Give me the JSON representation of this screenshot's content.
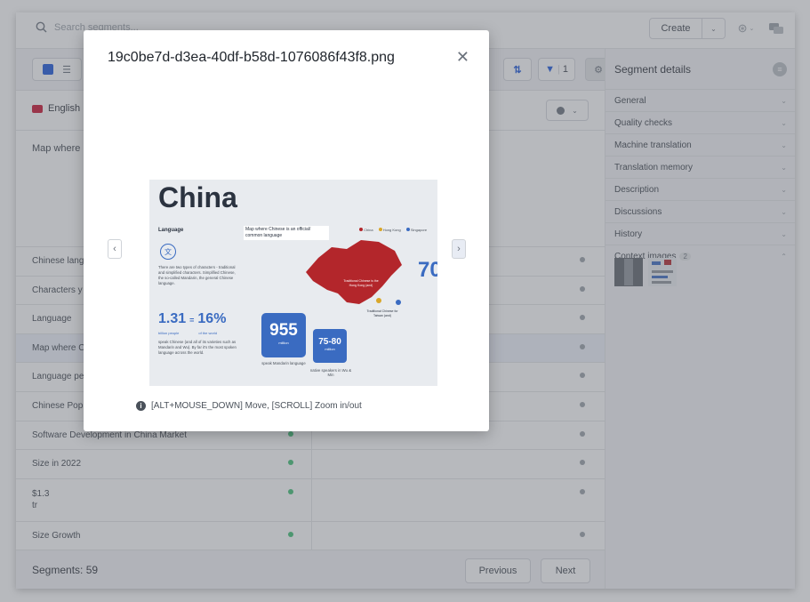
{
  "topbar": {
    "search_placeholder": "Search segments...",
    "create_label": "Create"
  },
  "toolbar": {
    "filter_count": "1"
  },
  "lang": {
    "source_language": "English"
  },
  "editor": {
    "source_text_preview": "Map where"
  },
  "segments": [
    {
      "source": "Chinese lang",
      "selected": false
    },
    {
      "source": "Characters y",
      "selected": false
    },
    {
      "source": "Language",
      "selected": false
    },
    {
      "source": "Map where C",
      "selected": true
    },
    {
      "source": "Language pe",
      "selected": false
    },
    {
      "source": "Chinese Pop",
      "selected": false
    },
    {
      "source": "Software Development in China Market",
      "selected": false
    },
    {
      "source": "Size in 2022",
      "selected": false
    },
    {
      "source_line1": "$1.3",
      "source_line2": "tr",
      "selected": false
    },
    {
      "source": "Size Growth",
      "selected": false
    }
  ],
  "footer": {
    "segments_count": "Segments: 59",
    "previous_label": "Previous",
    "next_label": "Next"
  },
  "right_panel": {
    "title": "Segment details",
    "sections": [
      {
        "label": "General"
      },
      {
        "label": "Quality checks"
      },
      {
        "label": "Machine translation"
      },
      {
        "label": "Translation memory"
      },
      {
        "label": "Description"
      },
      {
        "label": "Discussions"
      },
      {
        "label": "History"
      }
    ],
    "context_images_label": "Context images",
    "context_images_count": "2"
  },
  "modal": {
    "title": "19c0be7d-d3ea-40df-b58d-1076086f43f8.png",
    "hint": "[ALT+MOUSE_DOWN] Move, [SCROLL] Zoom in/out",
    "image": {
      "heading": "China",
      "language_label": "Language",
      "callout": "Map where Chinese is an official/ common language",
      "legend": [
        "China",
        "Hong Kong",
        "Singapore"
      ],
      "desc": "There are two types of characters - traditional and simplified characters. Simplified Chinese, the so-called Mandarin, the general Chinese language.",
      "stat1": "1.31",
      "stat1_unit": "billion people",
      "eq": "=",
      "stat2": "16%",
      "stat2_unit": "of the world",
      "stat_desc": "speak Chinese (and all of its varieties such as Mandarin and Wu). By far it's the most spoken language across the world.",
      "big1": "955",
      "big1_unit": "million",
      "big1_desc": "speak Mandarin language",
      "big2": "75-80",
      "big2_unit": "million",
      "big2_desc": "native speakers in Wu & Min",
      "right_stat": "70",
      "map_label1": "Traditional Chinese is the Hong Kong (and)",
      "map_label2": "Traditional Chinese for Taiwan (and)"
    }
  },
  "colors": {
    "accent": "#1a56db",
    "map_red": "#b3262b",
    "stat_blue": "#3a6bc1",
    "status_green": "#3fbf74"
  }
}
